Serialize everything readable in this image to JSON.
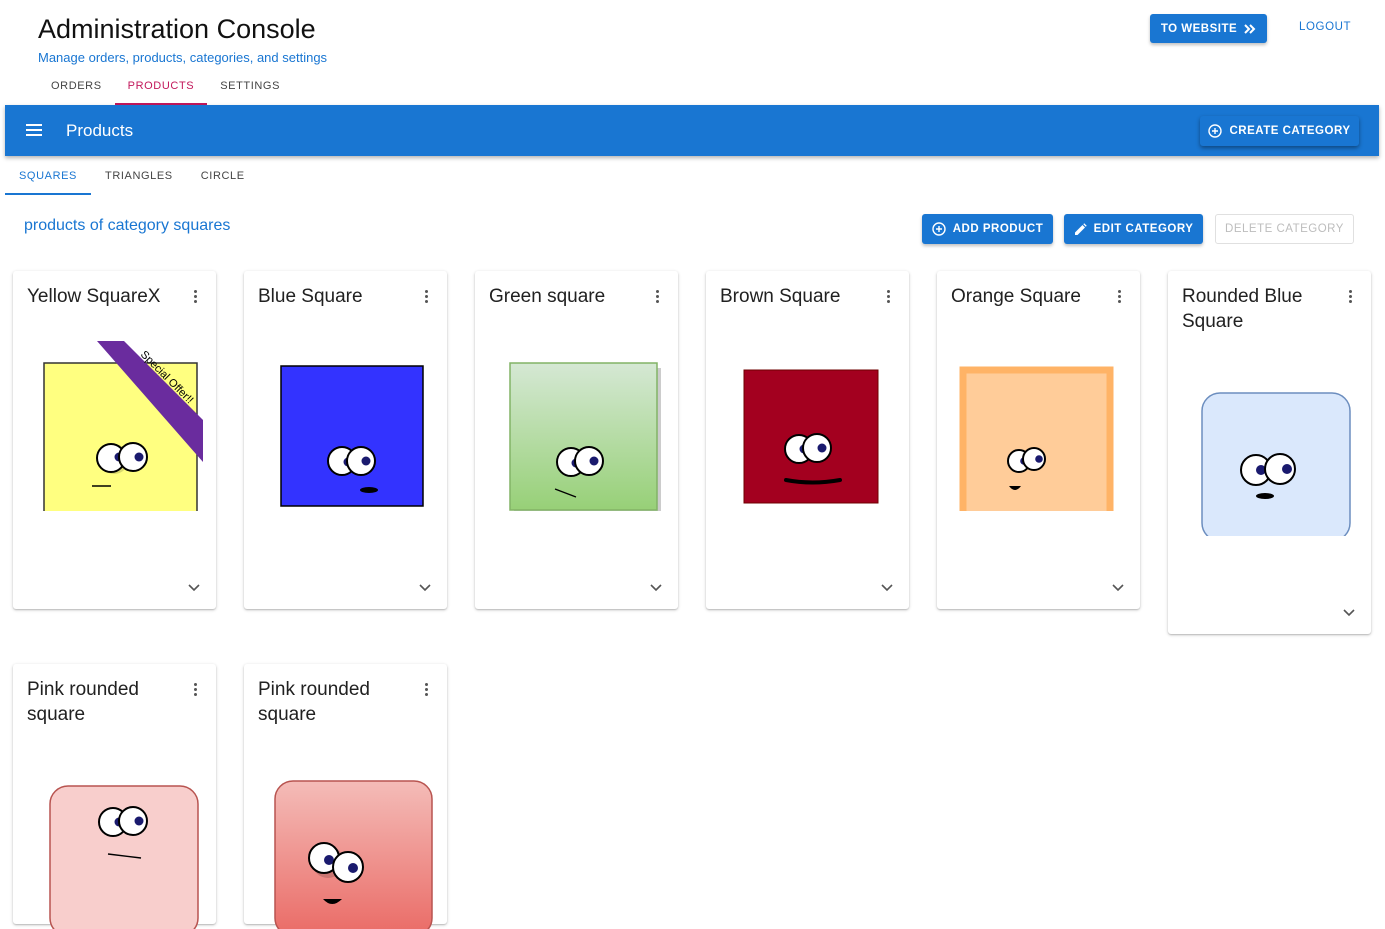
{
  "header": {
    "title": "Administration Console",
    "subtitle": "Manage orders, products, categories, and settings",
    "to_website_label": "TO WEBSITE",
    "logout_label": "LOGOUT"
  },
  "top_tabs": [
    {
      "label": "ORDERS",
      "active": false
    },
    {
      "label": "PRODUCTS",
      "active": true
    },
    {
      "label": "SETTINGS",
      "active": false
    }
  ],
  "toolbar": {
    "title": "Products",
    "create_category_label": "CREATE CATEGORY"
  },
  "category_tabs": [
    {
      "label": "SQUARES",
      "active": true
    },
    {
      "label": "TRIANGLES",
      "active": false
    },
    {
      "label": "CIRCLE",
      "active": false
    }
  ],
  "category_section": {
    "heading": "products of category squares",
    "add_product_label": "ADD PRODUCT",
    "edit_category_label": "EDIT CATEGORY",
    "delete_category_label": "DELETE CATEGORY"
  },
  "products": [
    {
      "name": "Yellow SquareX",
      "ribbon": "Special Offer!!",
      "color": "#ffff80"
    },
    {
      "name": "Blue Square",
      "color": "#3333ff"
    },
    {
      "name": "Green square",
      "color": "#a6d88f"
    },
    {
      "name": "Brown Square",
      "color": "#a3001f"
    },
    {
      "name": "Orange Square",
      "color": "#ffcc99"
    },
    {
      "name": "Rounded Blue Square",
      "color": "#dae8fc"
    },
    {
      "name": "Pink rounded square",
      "color": "#f8cecc"
    },
    {
      "name": "Pink rounded square",
      "color": "#ea6b66"
    }
  ],
  "theme": {
    "primary": "#1976d2",
    "accent": "#c2185b",
    "ribbon": "#6a2c9e"
  },
  "icons": {
    "menu": "menu-icon",
    "website": "double-chevron-right-icon",
    "create": "add-circle-icon",
    "add": "add-circle-icon",
    "edit": "pencil-icon",
    "card_menu": "more-vert-icon",
    "card_expand": "chevron-down-icon"
  }
}
